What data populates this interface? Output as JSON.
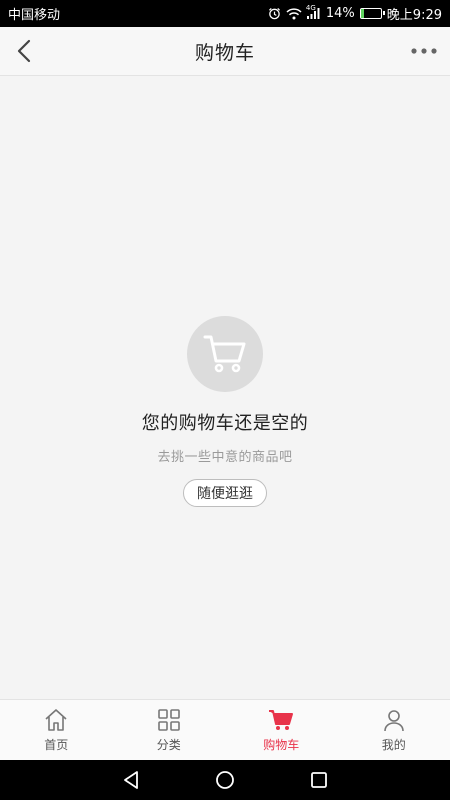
{
  "status_bar": {
    "carrier": "中国移动",
    "network": "4G",
    "battery": "14%",
    "battery_level": 0.14,
    "time": "晚上9:29"
  },
  "header": {
    "title": "购物车",
    "back_icon": "chevron-left-icon",
    "more_icon": "more-dots-icon"
  },
  "empty_state": {
    "icon": "shopping-cart-icon",
    "title": "您的购物车还是空的",
    "subtitle": "去挑一些中意的商品吧",
    "button_label": "随便逛逛"
  },
  "tabbar": {
    "active_color": "#e8334a",
    "items": [
      {
        "label": "首页",
        "icon": "home-icon"
      },
      {
        "label": "分类",
        "icon": "category-grid-icon"
      },
      {
        "label": "购物车",
        "icon": "shopping-cart-icon",
        "active": true
      },
      {
        "label": "我的",
        "icon": "user-icon"
      }
    ]
  },
  "navbar": {
    "items": [
      "back-triangle-icon",
      "home-circle-icon",
      "recents-square-icon"
    ]
  }
}
